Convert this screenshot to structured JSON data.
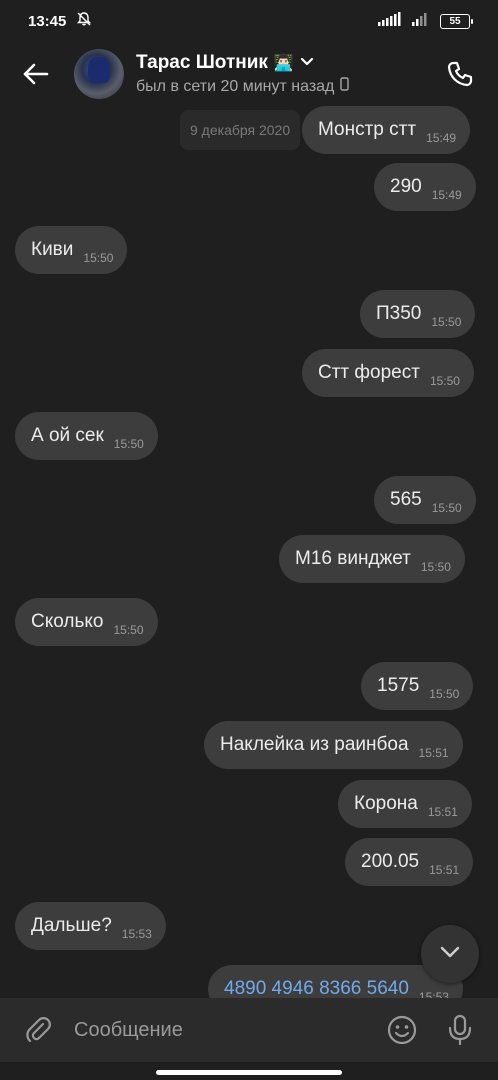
{
  "status_bar": {
    "time": "13:45",
    "battery": "55",
    "mute_icon": "bell-off-icon"
  },
  "header": {
    "contact_name": "Тарас Шотник",
    "name_emoji": "👨🏻‍💻",
    "status": "был в сети 20 минут назад"
  },
  "chat": {
    "date": "9 декабря 2020",
    "messages": [
      {
        "text": "Монстр стт",
        "time": "15:49",
        "side": "out"
      },
      {
        "text": "290",
        "time": "15:49",
        "side": "out"
      },
      {
        "text": "Киви",
        "time": "15:50",
        "side": "in"
      },
      {
        "text": "П350",
        "time": "15:50",
        "side": "out"
      },
      {
        "text": "Стт форест",
        "time": "15:50",
        "side": "out"
      },
      {
        "text": "А ой сек",
        "time": "15:50",
        "side": "in"
      },
      {
        "text": "565",
        "time": "15:50",
        "side": "out"
      },
      {
        "text": "М16 винджет",
        "time": "15:50",
        "side": "out"
      },
      {
        "text": "Сколько",
        "time": "15:50",
        "side": "in"
      },
      {
        "text": "1575",
        "time": "15:50",
        "side": "out"
      },
      {
        "text": "Наклейка из раинбоа",
        "time": "15:51",
        "side": "out"
      },
      {
        "text": "Корона",
        "time": "15:51",
        "side": "out"
      },
      {
        "text": "200.05",
        "time": "15:51",
        "side": "out"
      },
      {
        "text": "Дальше?",
        "time": "15:53",
        "side": "in"
      },
      {
        "text": "4890 4946 8366 5640",
        "time": "15:53",
        "side": "out",
        "link": true
      }
    ]
  },
  "composer": {
    "placeholder": "Сообщение"
  },
  "colors": {
    "background": "#1f1f1f",
    "bubble": "#3d3d3d",
    "link": "#71aaeb"
  }
}
